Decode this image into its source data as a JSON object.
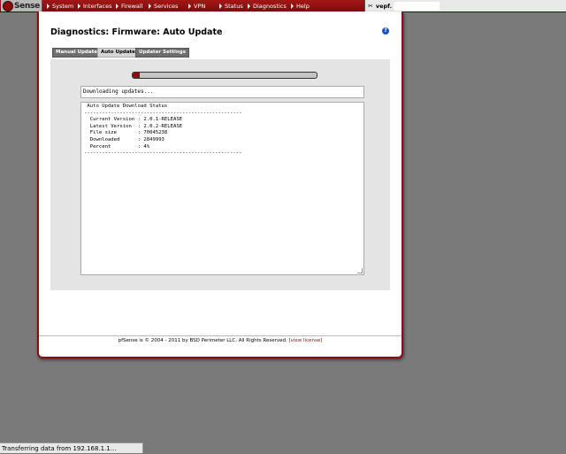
{
  "brand": {
    "logo_text": "Sense"
  },
  "nav": {
    "items": [
      {
        "label": "System"
      },
      {
        "label": "Interfaces"
      },
      {
        "label": "Firewall"
      },
      {
        "label": "Services"
      },
      {
        "label": "VPN"
      },
      {
        "label": "Status"
      },
      {
        "label": "Diagnostics"
      },
      {
        "label": "Help"
      }
    ],
    "host_label": "vepf."
  },
  "page": {
    "title": "Diagnostics: Firmware: Auto Update",
    "help_glyph": "?"
  },
  "tabs": [
    {
      "label": "Manual Update",
      "active": false
    },
    {
      "label": "Auto Update",
      "active": true
    },
    {
      "label": "Updater Settings",
      "active": false
    }
  ],
  "update": {
    "progress_percent": 4,
    "status_text": "Downloading updates...",
    "output_text": " Auto Update Download Status\n-----------------------------------------------------\n  Current Version : 2.0.1-RELEASE\n  Latest Version  : 2.0.2-RELEASE\n  File size       : 70045238\n  Downloaded      : 2849993\n  Percent         : 4%\n-----------------------------------------------------"
  },
  "footer": {
    "text": "pfSense is © 2004 - 2011 by BSD Perimeter LLC. All Rights Reserved. ",
    "link": "[view license]"
  },
  "statusbar": {
    "text": "Transferring data from 192.168.1.1..."
  },
  "colors": {
    "brand_red": "#8b0e0e",
    "nav_red": "#a31616",
    "background": "#7a7a7a"
  }
}
